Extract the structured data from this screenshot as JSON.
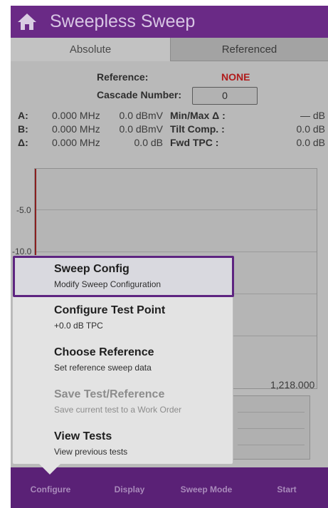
{
  "header": {
    "title": "Sweepless Sweep",
    "home_icon": "home-icon"
  },
  "tabs": [
    {
      "label": "Absolute",
      "active": true
    },
    {
      "label": "Referenced",
      "active": false
    }
  ],
  "reference": {
    "label": "Reference:",
    "value": "NONE",
    "value_color": "#b01c1c"
  },
  "cascade": {
    "label": "Cascade Number:",
    "value": "0"
  },
  "markers": [
    {
      "label": "A:",
      "freq": "0.000 MHz",
      "level": "0.0 dBmV"
    },
    {
      "label": "B:",
      "freq": "0.000 MHz",
      "level": "0.0 dBmV"
    },
    {
      "label": "Δ:",
      "freq": "0.000 MHz",
      "level": "0.0 dB"
    }
  ],
  "stats": [
    {
      "label": "Min/Max Δ :",
      "value": "— dB"
    },
    {
      "label": "Tilt Comp. :",
      "value": "0.0 dB"
    },
    {
      "label": "Fwd TPC :",
      "value": "0.0 dB"
    }
  ],
  "graph": {
    "y_ticks": [
      "-5.0",
      "-10.0"
    ],
    "x_end": "1,218.000"
  },
  "menu": {
    "items": [
      {
        "title": "Sweep Config",
        "subtitle": "Modify Sweep Configuration",
        "selected": true,
        "enabled": true
      },
      {
        "title": "Configure Test Point",
        "subtitle": "+0.0 dB TPC",
        "selected": false,
        "enabled": true
      },
      {
        "title": "Choose Reference",
        "subtitle": "Set reference sweep data",
        "selected": false,
        "enabled": true
      },
      {
        "title": "Save Test/Reference",
        "subtitle": "Save current test to a Work Order",
        "selected": false,
        "enabled": false
      },
      {
        "title": "View Tests",
        "subtitle": "View previous tests",
        "selected": false,
        "enabled": true
      }
    ]
  },
  "bottom_nav": [
    {
      "label": "Configure"
    },
    {
      "label": "Display"
    },
    {
      "label": "Sweep Mode"
    },
    {
      "label": "Start"
    }
  ],
  "colors": {
    "header": "#6a2a86",
    "bottom_bar": "#5a2176",
    "accent": "#5d2480"
  }
}
